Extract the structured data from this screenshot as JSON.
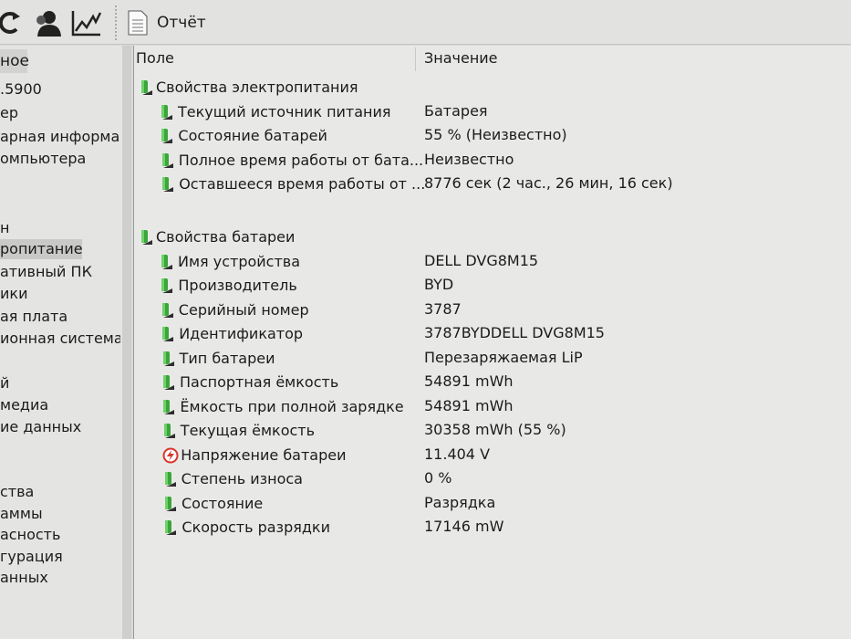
{
  "toolbar": {
    "report_label": "Отчёт",
    "icons": [
      "refresh-icon",
      "user-icon",
      "chart-icon",
      "report-icon"
    ]
  },
  "sidebar": {
    "header": "ное",
    "items": [
      ".5900",
      "ер",
      "арная информац",
      "омпьютера",
      "н",
      "ропитание",
      "ативный ПК",
      "ики",
      "ая плата",
      "ионная система",
      "й",
      "медиа",
      "ие данных",
      "ства",
      "аммы",
      "асность",
      "гурация",
      "анных"
    ],
    "selected": "ропитание"
  },
  "table": {
    "col_field": "Поле",
    "col_value": "Значение",
    "groups": [
      {
        "title": "Свойства электропитания",
        "rows": [
          {
            "field": "Текущий источник питания",
            "value": "Батарея"
          },
          {
            "field": "Состояние батарей",
            "value": "55 % (Неизвестно)"
          },
          {
            "field": "Полное время работы от бата...",
            "value": "Неизвестно"
          },
          {
            "field": "Оставшееся время работы от ...",
            "value": "8776 сек (2 час., 26 мин, 16 сек)"
          }
        ]
      },
      {
        "title": "Свойства батареи",
        "rows": [
          {
            "field": "Имя устройства",
            "value": "DELL DVG8M15"
          },
          {
            "field": "Производитель",
            "value": "BYD"
          },
          {
            "field": "Серийный номер",
            "value": "3787"
          },
          {
            "field": "Идентификатор",
            "value": "3787BYDDELL DVG8M15"
          },
          {
            "field": "Тип батареи",
            "value": "Перезаряжаемая LiP"
          },
          {
            "field": "Паспортная ёмкость",
            "value": "54891 mWh"
          },
          {
            "field": "Ёмкость при полной зарядке",
            "value": "54891 mWh"
          },
          {
            "field": "Текущая ёмкость",
            "value": "30358 mWh  (55 %)"
          },
          {
            "field": "Напряжение батареи",
            "value": "11.404 V",
            "icon": "voltage-icon"
          },
          {
            "field": "Степень износа",
            "value": "0 %"
          },
          {
            "field": "Состояние",
            "value": "Разрядка"
          },
          {
            "field": "Скорость разрядки",
            "value": "17146 mW"
          }
        ]
      }
    ]
  },
  "colors": {
    "battery_icon": "#3aa63a",
    "voltage_icon": "#d9342b"
  }
}
